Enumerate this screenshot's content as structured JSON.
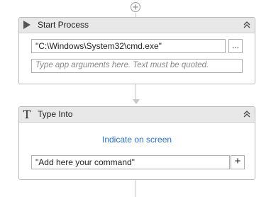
{
  "workflow": {
    "add_activity_icon": "plus-circle-icon",
    "activities": [
      {
        "title": "Start Process",
        "icon": "play-triangle-icon",
        "collapse_icon": "double-chevron-up-icon",
        "file_name_value": "\"C:\\Windows\\System32\\cmd.exe\"",
        "browse_label": "...",
        "arguments_placeholder": "Type app arguments here. Text must be quoted."
      },
      {
        "title": "Type Into",
        "icon": "type-into-t-icon",
        "collapse_icon": "double-chevron-up-icon",
        "indicate_label": "Indicate on screen",
        "text_value": "\"Add here your command\"",
        "add_label": "+"
      }
    ]
  },
  "colors": {
    "header_bg": "#e8e8e8",
    "border": "#b9b9b9",
    "link": "#2b6fc2",
    "connector": "#c8c8c8"
  }
}
